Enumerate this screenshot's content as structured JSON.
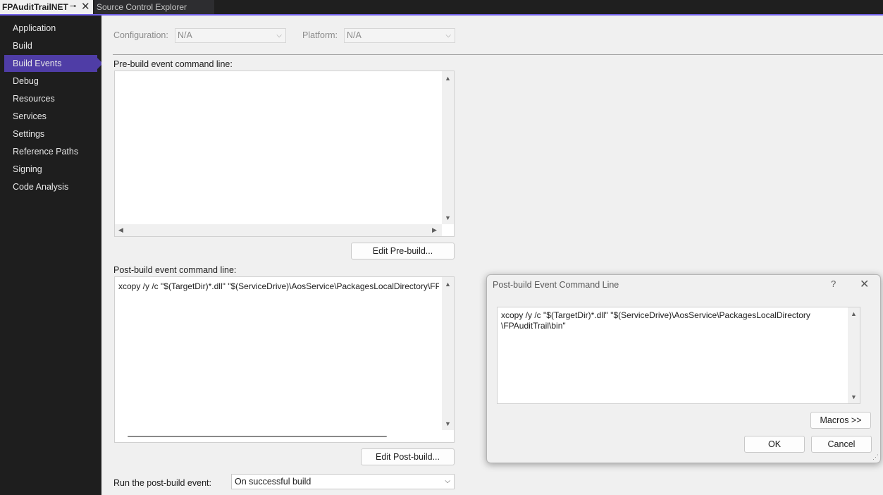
{
  "tabs": {
    "active_title": "FPAuditTrailNET",
    "pin_glyph": "⊸",
    "close_glyph": "✕",
    "inactive_title": "Source Control Explorer"
  },
  "sidebar": {
    "items": [
      {
        "label": "Application"
      },
      {
        "label": "Build"
      },
      {
        "label": "Build Events",
        "active": true
      },
      {
        "label": "Debug"
      },
      {
        "label": "Resources"
      },
      {
        "label": "Services"
      },
      {
        "label": "Settings"
      },
      {
        "label": "Reference Paths"
      },
      {
        "label": "Signing"
      },
      {
        "label": "Code Analysis"
      }
    ]
  },
  "config": {
    "configuration_label": "Configuration:",
    "configuration_value": "N/A",
    "platform_label": "Platform:",
    "platform_value": "N/A"
  },
  "prebuild": {
    "label": "Pre-build event command line:",
    "text": "",
    "edit_button": "Edit Pre-build..."
  },
  "postbuild": {
    "label": "Post-build event command line:",
    "text": "xcopy /y /c \"$(TargetDir)*.dll\" \"$(ServiceDrive)\\AosService\\PackagesLocalDirectory\\FPA",
    "edit_button": "Edit Post-build..."
  },
  "run_event": {
    "label": "Run the post-build event:",
    "value": "On successful build"
  },
  "dialog": {
    "title": "Post-build Event Command Line",
    "help_glyph": "?",
    "close_glyph": "✕",
    "text": "xcopy /y /c \"$(TargetDir)*.dll\" \"$(ServiceDrive)\\AosService\\PackagesLocalDirectory\n\\FPAuditTrail\\bin\"",
    "macros_button": "Macros >>",
    "ok_button": "OK",
    "cancel_button": "Cancel"
  },
  "icons": {
    "scroll_up": "▲",
    "scroll_down": "▼",
    "scroll_left": "◀",
    "scroll_right": "▶",
    "dropdown": "⌵",
    "resize_grip": "⋰"
  }
}
